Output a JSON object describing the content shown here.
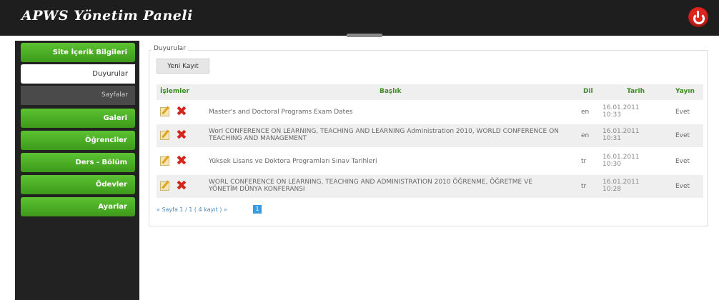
{
  "header": {
    "title": "APWS Yönetim Paneli",
    "power_icon": "power-icon"
  },
  "sidebar": {
    "sections": [
      {
        "label": "Site İçerik Bilgileri"
      },
      {
        "label": "Duyurular"
      },
      {
        "label": "Sayfalar"
      },
      {
        "label": "Galeri"
      },
      {
        "label": "Öğrenciler"
      },
      {
        "label": "Ders - Bölüm"
      },
      {
        "label": "Ödevler"
      },
      {
        "label": "Ayarlar"
      }
    ]
  },
  "content": {
    "legend": "Duyurular",
    "new_button": "Yeni Kayıt",
    "columns": {
      "islemler": "İşlemler",
      "baslik": "Başlık",
      "dil": "Dil",
      "tarih": "Tarih",
      "yayin": "Yayın"
    },
    "rows": [
      {
        "baslik": "Master's and Doctoral Programs Exam Dates",
        "dil": "en",
        "tarih_d": "16.01.2011",
        "tarih_t": "10:33",
        "yayin": "Evet"
      },
      {
        "baslik": "Worl CONFERENCE ON LEARNING, TEACHING AND LEARNING Administration 2010, WORLD CONFERENCE ON TEACHING AND MANAGEMENT",
        "dil": "en",
        "tarih_d": "16.01.2011",
        "tarih_t": "10:31",
        "yayin": "Evet"
      },
      {
        "baslik": "Yüksek Lisans ve Doktora Programları Sınav Tarihleri",
        "dil": "tr",
        "tarih_d": "16.01.2011",
        "tarih_t": "10:30",
        "yayin": "Evet"
      },
      {
        "baslik": "WORL CONFERENCE ON LEARNING, TEACHING AND ADMINISTRATION 2010 ÖĞRENME, ÖĞRETME VE YÖNETİM DÜNYA KONFERANSI",
        "dil": "tr",
        "tarih_d": "16.01.2011",
        "tarih_t": "10:28",
        "yayin": "Evet"
      }
    ],
    "pager": "« Sayfa 1 / 1 ( 4 kayıt ) »",
    "current_page": "1"
  },
  "colors": {
    "green": "#4aa823",
    "dark": "#1e1e1e",
    "header_text": "#3c8d1f",
    "delete": "#d62519"
  }
}
